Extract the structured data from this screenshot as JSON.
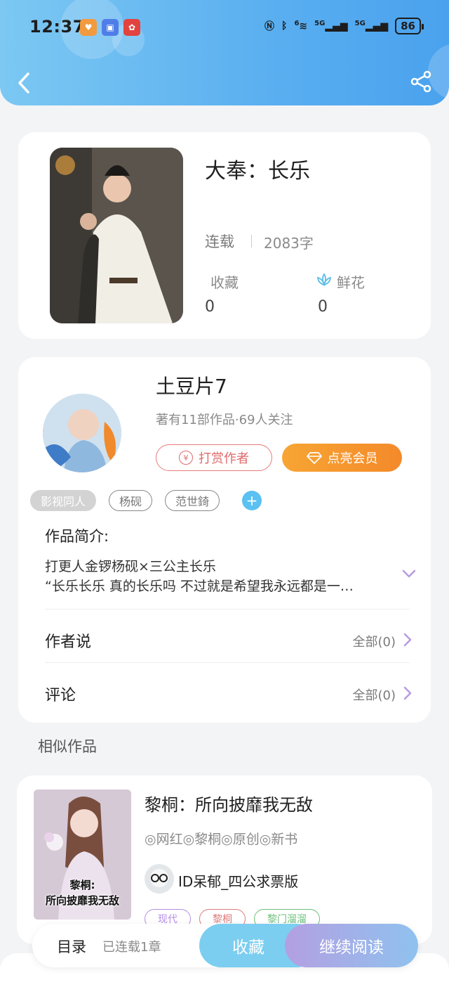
{
  "status_bar": {
    "time": "12:37",
    "battery": "86",
    "signal_1": "5G",
    "signal_2": "5G",
    "wifi_level": "6"
  },
  "book": {
    "title": "大奉：长乐",
    "status": "连载",
    "word_count": "2083字",
    "collect_label": "收藏",
    "collect_count": "0",
    "flower_label": "鲜花",
    "flower_count": "0"
  },
  "author": {
    "name": "土豆片7",
    "meta": "著有11部作品·69人关注",
    "tip_label": "打赏作者",
    "tip_coin": "¥",
    "vip_label": "点亮会员"
  },
  "tags": [
    "影视同人",
    "杨砚",
    "范世錡"
  ],
  "intro": {
    "label": "作品简介:",
    "line1": "打更人金锣杨砚×三公主长乐",
    "line2": "“长乐长乐 真的长乐吗 不过就是希望我永远都是一…"
  },
  "author_says": {
    "label": "作者说",
    "right": "全部(0)"
  },
  "comments": {
    "label": "评论",
    "right": "全部(0)"
  },
  "similar": {
    "section_title": "相似作品",
    "title": "黎桐：所向披靡我无敌",
    "tags_text": "◎网红◎黎桐◎原创◎新书",
    "author": "ID呆郁_四公求票版",
    "cover_text_1": "黎桐:",
    "cover_text_2": "所向披靡我无敌",
    "pills": [
      {
        "label": "现代",
        "color": "#b58ee6"
      },
      {
        "label": "黎桐",
        "color": "#e07a7a"
      },
      {
        "label": "黎门溜溜",
        "color": "#6cbf7a"
      }
    ]
  },
  "bottom_bar": {
    "toc_label": "目录",
    "chapters_label": "已连载1章",
    "collect_label": "收藏",
    "read_label": "继续阅读"
  },
  "colors": {
    "header_blue": "#5aaff0",
    "vip_orange": "#f48a2a",
    "tip_red": "#e06a6a",
    "accent_purple": "#b39fe2",
    "add_blue": "#5bc0f2"
  },
  "icons": {
    "back": "chevron-left-icon",
    "share": "share-icon",
    "flower": "lotus-icon",
    "expand": "chevron-down-icon",
    "row": "chevron-right-icon"
  }
}
